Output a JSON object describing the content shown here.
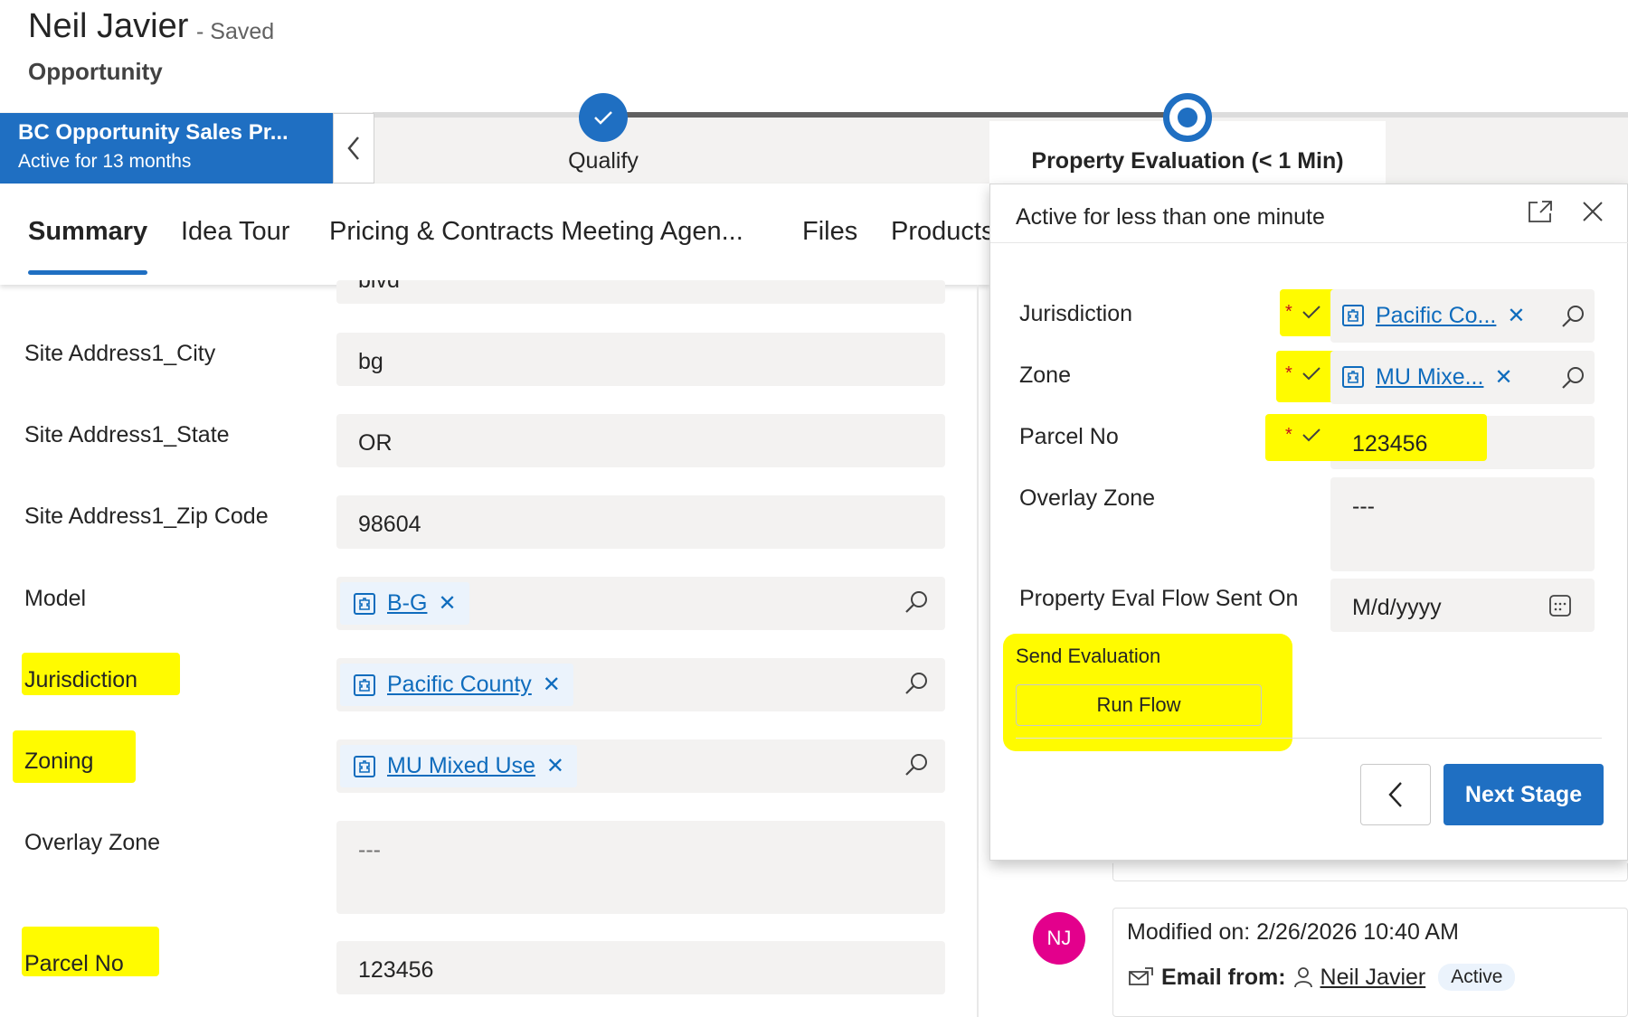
{
  "record": {
    "title": "Neil Javier",
    "saved_status": "- Saved",
    "entity": "Opportunity"
  },
  "bpf": {
    "process_name": "BC Opportunity Sales Pr...",
    "process_duration": "Active for 13 months",
    "stages": [
      {
        "label": "Qualify",
        "state": "completed"
      },
      {
        "label": "Property Evaluation  (< 1 Min)",
        "state": "active"
      }
    ]
  },
  "tabs": [
    {
      "label": "Summary",
      "active": true
    },
    {
      "label": "Idea Tour"
    },
    {
      "label": "Pricing & Contracts Meeting Agen..."
    },
    {
      "label": "Files"
    },
    {
      "label": "Products"
    }
  ],
  "form": {
    "partial_value": "blvd",
    "fields": [
      {
        "label": "Site Address1_City",
        "value": "bg"
      },
      {
        "label": "Site Address1_State",
        "value": "OR"
      },
      {
        "label": "Site Address1_Zip Code",
        "value": "98604"
      },
      {
        "label": "Model",
        "lookup": "B-G"
      },
      {
        "label": "Jurisdiction",
        "lookup": "Pacific County"
      },
      {
        "label": "Zoning",
        "lookup": "MU Mixed Use"
      },
      {
        "label": "Overlay Zone",
        "value": "---"
      },
      {
        "label": "Parcel No",
        "value": "123456"
      }
    ]
  },
  "flyout": {
    "active_text": "Active for less than one minute",
    "required_mark": "*",
    "fields": [
      {
        "label": "Jurisdiction",
        "lookup": "Pacific Co..."
      },
      {
        "label": "Zone",
        "lookup": "MU Mixe..."
      },
      {
        "label": "Parcel No",
        "value": "123456"
      },
      {
        "label": "Overlay Zone",
        "value": "---"
      },
      {
        "label": "Property Eval Flow Sent On",
        "placeholder": "M/d/yyyy"
      }
    ],
    "section_label": "Send Evaluation",
    "run_flow_label": "Run Flow",
    "next_stage_label": "Next Stage"
  },
  "timeline": {
    "avatar_initials": "NJ",
    "modified_on": "Modified on: 2/26/2026 10:40 AM",
    "email_from_label": "Email from:",
    "email_from_name": "Neil Javier",
    "status": "Active"
  },
  "colors": {
    "brand": "#1f6fc2",
    "highlight": "#fffb00",
    "field_bg": "#f3f2f1",
    "link": "#0f6cbd",
    "required": "#c50f1f",
    "avatar": "#e3008c"
  },
  "icons": [
    "chevron-left-icon",
    "checkmark-icon",
    "lookup-entity-icon",
    "dismiss-icon",
    "search-icon",
    "expand-icon",
    "close-icon",
    "calendar-icon",
    "email-icon",
    "person-icon"
  ]
}
